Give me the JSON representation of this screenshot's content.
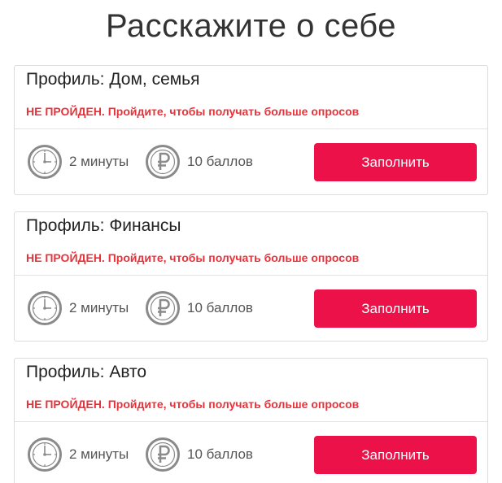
{
  "page": {
    "title": "Расскажите о себе"
  },
  "colors": {
    "accent": "#ed114a",
    "status": "#e8323a",
    "icon": "#8a8a8a"
  },
  "icons": {
    "time": "clock-icon",
    "points": "ruble-icon"
  },
  "cards": [
    {
      "title": "Профиль: Дом, семья",
      "status": "НЕ ПРОЙДЕН. Пройдите, чтобы получать больше опросов",
      "duration": "2 минуты",
      "points": "10 баллов",
      "button_label": "Заполнить"
    },
    {
      "title": "Профиль: Финансы",
      "status": "НЕ ПРОЙДЕН. Пройдите, чтобы получать больше опросов",
      "duration": "2 минуты",
      "points": "10 баллов",
      "button_label": "Заполнить"
    },
    {
      "title": "Профиль: Авто",
      "status": "НЕ ПРОЙДЕН. Пройдите, чтобы получать больше опросов",
      "duration": "2 минуты",
      "points": "10 баллов",
      "button_label": "Заполнить"
    }
  ]
}
